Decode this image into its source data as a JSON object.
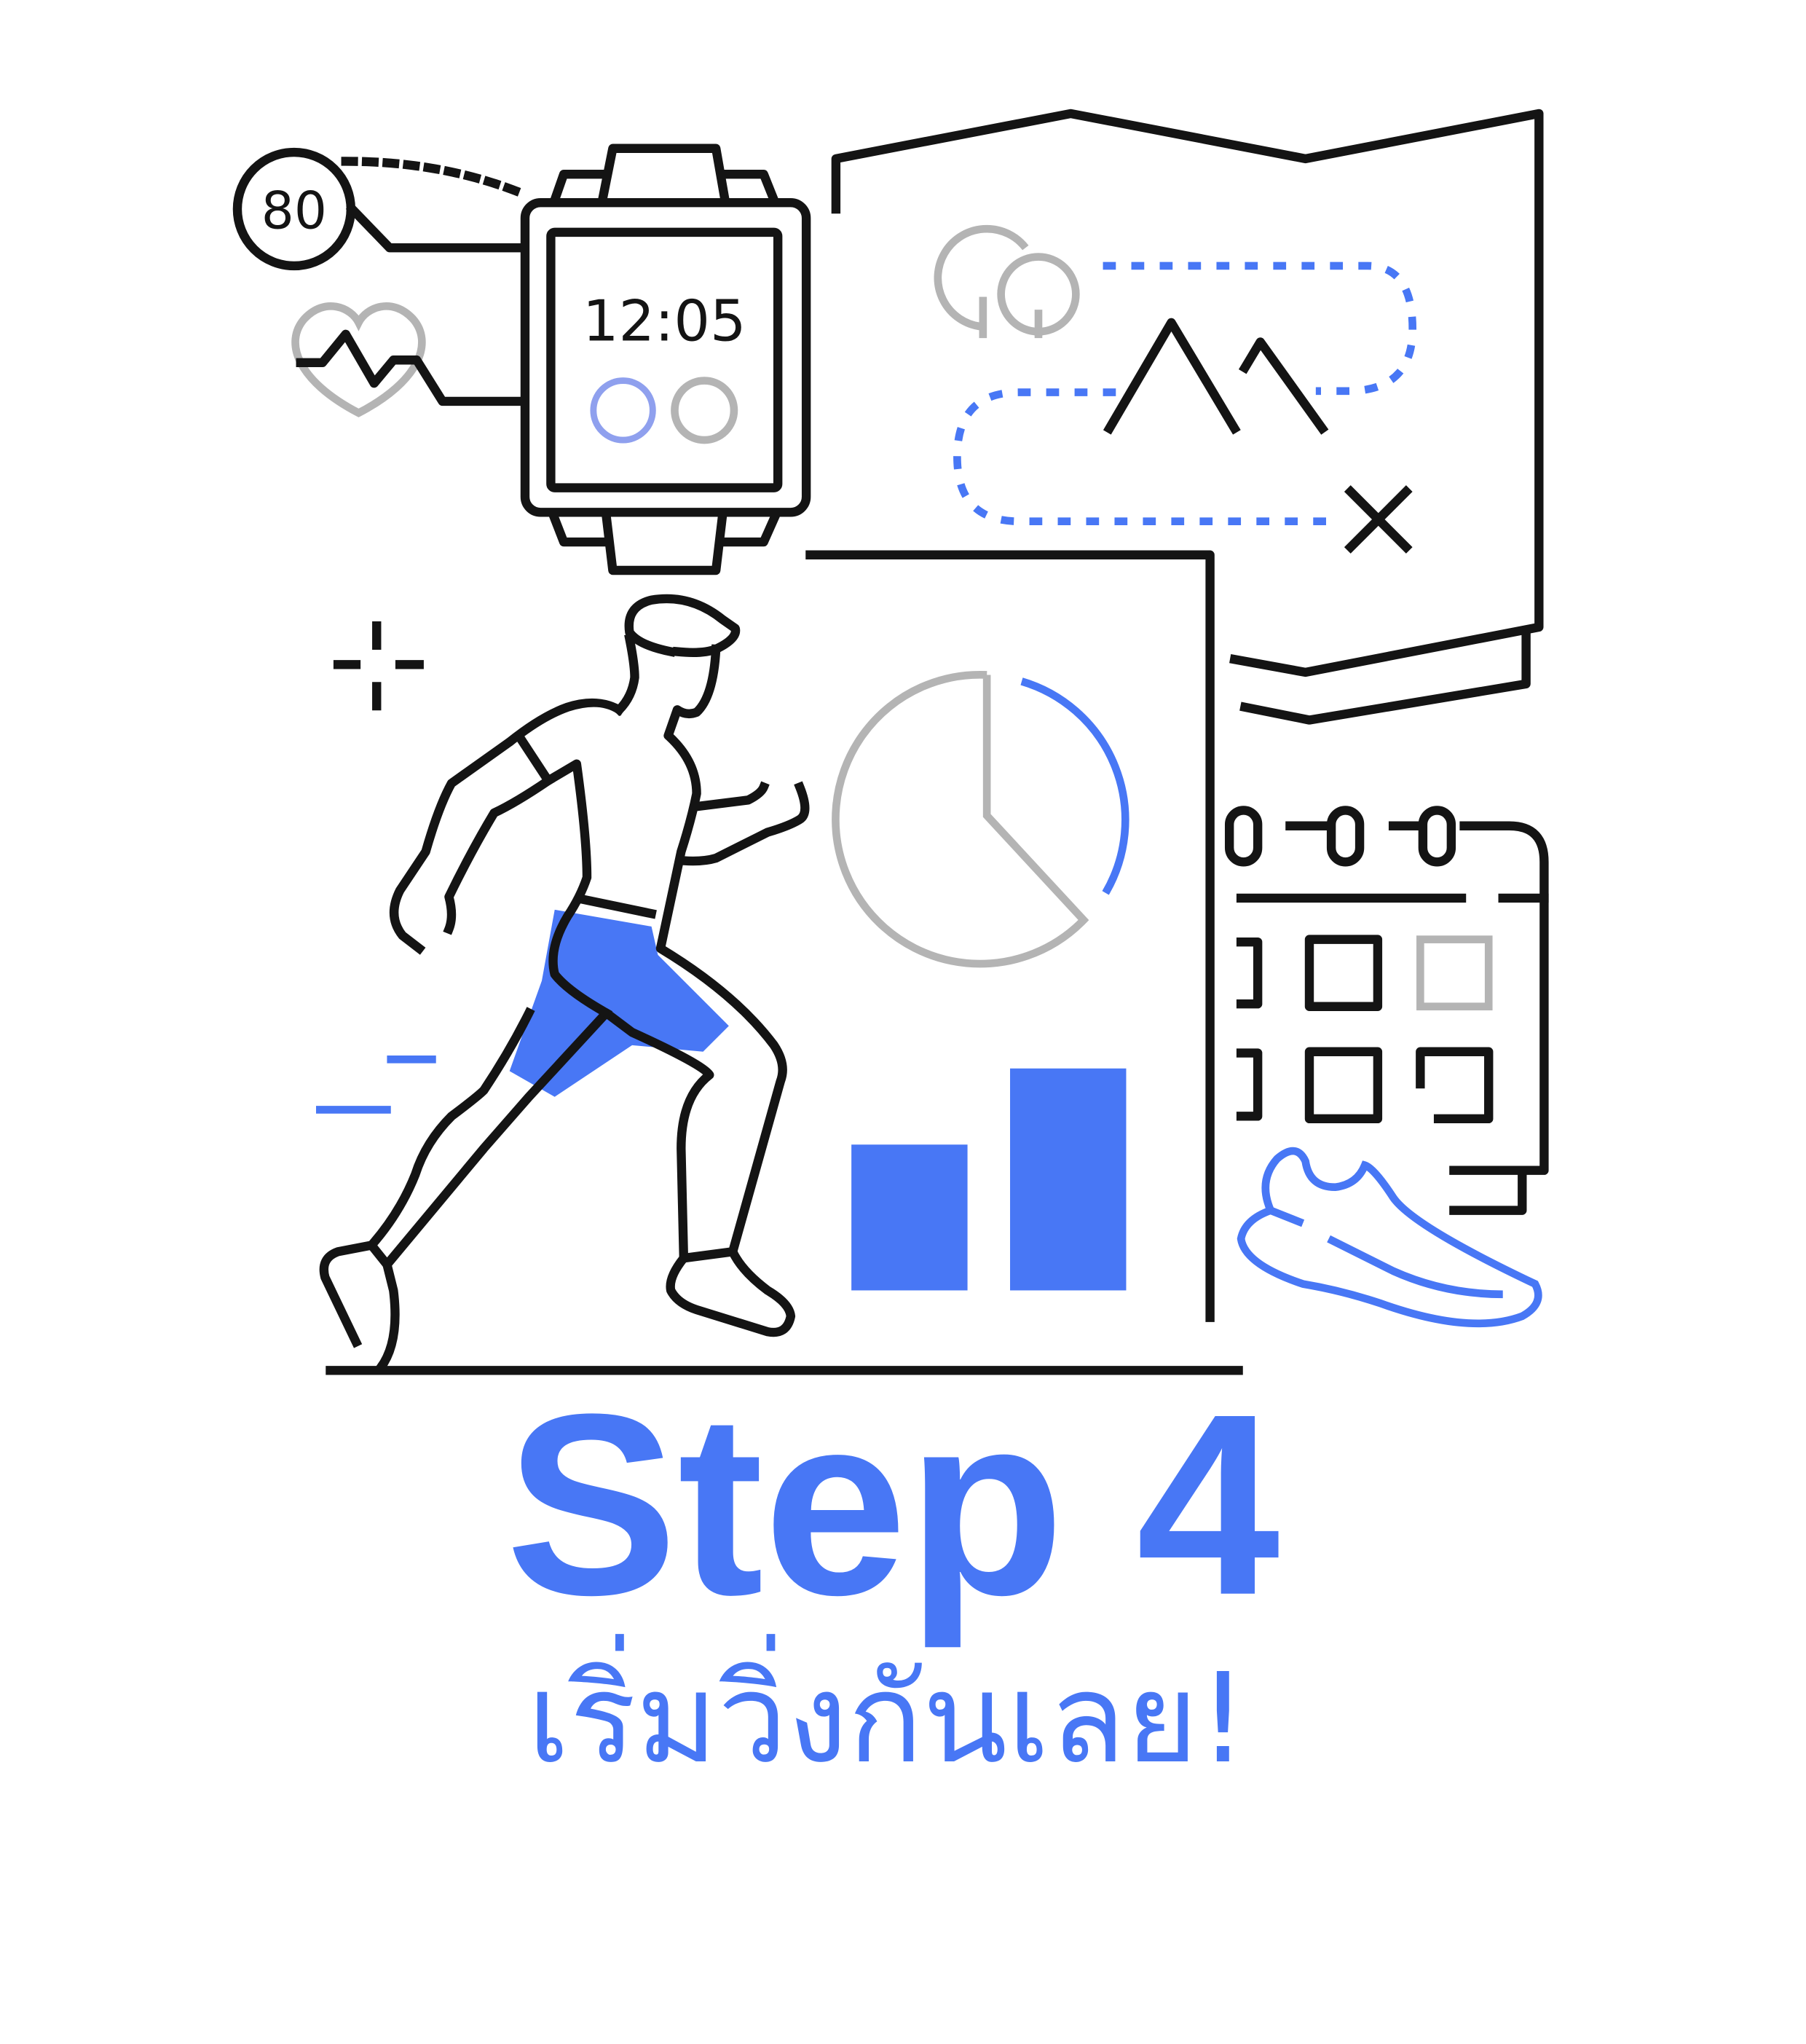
{
  "watch": {
    "heart_rate": "80",
    "time": "12:05"
  },
  "title": {
    "step": "Step 4",
    "subtitle": "เริ่มวิ่งกันเลย!"
  },
  "colors": {
    "accent": "#4877f5",
    "line": "#141414",
    "muted": "#b4b4b4"
  }
}
